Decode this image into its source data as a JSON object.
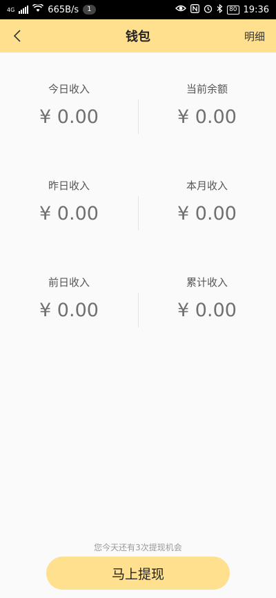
{
  "status_bar": {
    "network": "4G",
    "speed": "665B/s",
    "notification_count": "1",
    "battery": "80",
    "time": "19:36",
    "icons": [
      "signal-icon",
      "wifi-icon",
      "eye-icon",
      "nfc-icon",
      "alarm-icon",
      "bluetooth-icon",
      "battery-icon"
    ]
  },
  "header": {
    "title": "钱包",
    "detail_label": "明细",
    "background": "#ffe08f"
  },
  "stats": [
    {
      "label": "今日收入",
      "value": "¥ 0.00"
    },
    {
      "label": "当前余额",
      "value": "¥ 0.00"
    },
    {
      "label": "昨日收入",
      "value": "¥ 0.00"
    },
    {
      "label": "本月收入",
      "value": "¥ 0.00"
    },
    {
      "label": "前日收入",
      "value": "¥ 0.00"
    },
    {
      "label": "累计收入",
      "value": "¥ 0.00"
    }
  ],
  "notice": "您今天还有3次提现机会",
  "withdraw_button": "马上提现"
}
